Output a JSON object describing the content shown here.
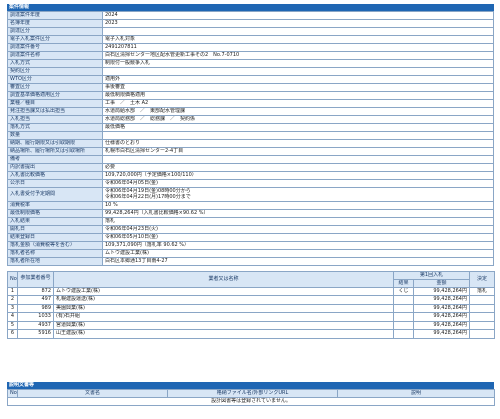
{
  "section_title": "案件情報",
  "info": [
    {
      "label": "調達案件年度",
      "value": "2024"
    },
    {
      "label": "名簿年度",
      "value": "2023"
    },
    {
      "label": "調達区分",
      "value": ""
    },
    {
      "label": "電子入札案件区分",
      "value": "電子入札対象"
    },
    {
      "label": "調達案件番号",
      "value": "2491207811"
    },
    {
      "label": "調達案件名称",
      "value": "白石区清掃センター地区配水管更新工事その2　No.7-0710"
    },
    {
      "label": "入札方式",
      "value": "制限付一般競争入札"
    },
    {
      "label": "契約区分",
      "value": ""
    },
    {
      "label": "WTO区分",
      "value": "適用外"
    },
    {
      "label": "審査区分",
      "value": "事後審査"
    },
    {
      "label": "調査基準価格適用区分",
      "value": "最低制限価格適用"
    },
    {
      "label": "業種／種目",
      "value": "工事　／　土木 A2"
    },
    {
      "label": "発注担当課又は払出担当",
      "value": "水道局給水部　／　東部配水管理課"
    },
    {
      "label": "入札担当",
      "value": "水道局総務部　／　総務課　／　契約係"
    },
    {
      "label": "落札方式",
      "value": "最低価格"
    },
    {
      "label": "数量",
      "value": ""
    },
    {
      "label": "納期、履行期限又は引取期限",
      "value": "仕様書のとおり"
    },
    {
      "label": "納品場所、履行場所又は引取場所",
      "value": "札幌市白石区清掃センター2-4丁目"
    },
    {
      "label": "備考",
      "value": ""
    },
    {
      "label": "内訳書提出",
      "value": "必要"
    },
    {
      "label": "入札書比較価格",
      "value": "109,720,000円（予定価格×100/110）"
    },
    {
      "label": "公示日",
      "value": "令和06年04月05日(金)"
    },
    {
      "label": "入札書受付予定期間",
      "value": "令和06年04月19日(金)08時00分から",
      "value2": "令和06年04月22日(月)17時00分まで",
      "tall": true
    },
    {
      "label": "消費税率",
      "value": "10 %"
    },
    {
      "label": "最低制限価格",
      "value": "99,428,264円（入札書比較価格×90.62 %）"
    },
    {
      "label": "入札結果",
      "value": "落札"
    },
    {
      "label": "開札日",
      "value": "令和06年04月23日(火)"
    },
    {
      "label": "結果登録日",
      "value": "令和06年05月10日(金)"
    },
    {
      "label": "落札金額（消費税等を含む）",
      "value": "109,371,090円（落札率 90.62 %）"
    },
    {
      "label": "落札者名称",
      "value": "ムトウ建設工業(株)"
    },
    {
      "label": "落札者所在地",
      "value": "白石区本郷通13丁目南4-27"
    }
  ],
  "results": {
    "headers": {
      "no": "No.",
      "code": "参加業者番号",
      "name": "業者又は名称",
      "round": "第1回入札",
      "result": "結果",
      "amount": "金額",
      "decision": "決定"
    },
    "rows": [
      {
        "no": "1",
        "code": "872",
        "name": "ムトウ建設工業(株)",
        "result": "くじ",
        "amount": "99,428,264円",
        "decision": "落札"
      },
      {
        "no": "2",
        "code": "497",
        "name": "札幌建設運送(株)",
        "result": "",
        "amount": "99,428,264円",
        "decision": ""
      },
      {
        "no": "3",
        "code": "989",
        "name": "美園興業(株)",
        "result": "",
        "amount": "99,428,264円",
        "decision": ""
      },
      {
        "no": "4",
        "code": "1033",
        "name": "(有)石井組",
        "result": "",
        "amount": "99,428,264円",
        "decision": ""
      },
      {
        "no": "5",
        "code": "4937",
        "name": "宮道興業(株)",
        "result": "",
        "amount": "99,428,264円",
        "decision": ""
      },
      {
        "no": "6",
        "code": "5916",
        "name": "山王建設(株)",
        "result": "",
        "amount": "99,428,264円",
        "decision": ""
      }
    ]
  },
  "docs_title": "説明文書等",
  "docs": {
    "headers": {
      "no": "No.",
      "name": "文書名",
      "file": "格納ファイル名/外部リンクURL",
      "desc": "説明"
    },
    "message": "設計図書等は登録されていません。"
  }
}
